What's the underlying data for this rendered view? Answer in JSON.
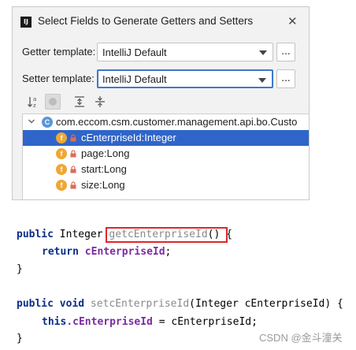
{
  "dialog": {
    "title": "Select Fields to Generate Getters and Setters",
    "app_icon_text": "IJ",
    "close_glyph": "✕",
    "getter": {
      "label": "Getter template:",
      "value": "IntelliJ Default",
      "more": "..."
    },
    "setter": {
      "label": "Setter template:",
      "value": "IntelliJ Default",
      "more": "..."
    },
    "toolbar": [
      "sort-alpha-icon",
      "show-classes-icon",
      "expand-all-icon",
      "collapse-all-icon"
    ],
    "tree": {
      "class_name": "com.eccom.csm.customer.management.api.bo.Custo",
      "class_icon": "C",
      "field_icon": "f",
      "fields": [
        "cEnterpriseId:Integer",
        "page:Long",
        "start:Long",
        "size:Long"
      ],
      "selected_index": 0
    },
    "colors": {
      "selection": "#2f65ca",
      "field_icon": "#f0a732",
      "class_icon": "#5a96d8"
    }
  },
  "code": {
    "line1": {
      "kw": "public",
      "type": " Integer ",
      "method": "getcEnterpriseId",
      "rest": "() {"
    },
    "line2": {
      "kw": "return",
      "field": "cEnterpriseId",
      "rest": ";"
    },
    "line3": "}",
    "line4": {
      "kw": "public void",
      "method": "setcEnterpriseId",
      "rest": "(Integer cEnterpriseId) {"
    },
    "line5": {
      "kw": "this",
      "field": ".cEnterpriseId",
      "rest": " = cEnterpriseId;"
    },
    "line6": "}",
    "colors": {
      "keyword": "#0b2e86",
      "field": "#7a2ba0",
      "highlight": "#e0262c"
    }
  },
  "watermark": "CSDN @金斗潼关"
}
